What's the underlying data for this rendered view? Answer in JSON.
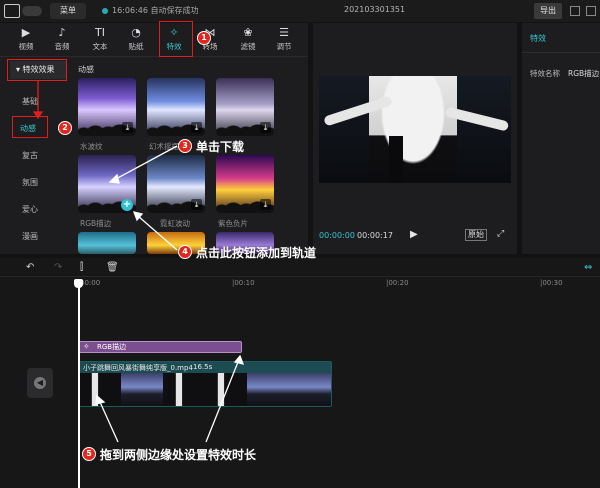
{
  "topbar": {
    "menu_label": "菜单",
    "status_text": "16:06:46 自动保存成功",
    "project_title": "202103301351",
    "export_label": "导出"
  },
  "media_tabs": [
    {
      "label": "视频",
      "icon": "video-icon"
    },
    {
      "label": "音频",
      "icon": "audio-icon"
    },
    {
      "label": "文本",
      "icon": "text-icon"
    },
    {
      "label": "贴纸",
      "icon": "sticker-icon"
    },
    {
      "label": "特效",
      "icon": "effects-icon",
      "active": true
    },
    {
      "label": "转场",
      "icon": "transition-icon"
    },
    {
      "label": "滤镜",
      "icon": "filter-icon"
    },
    {
      "label": "调节",
      "icon": "adjust-icon"
    }
  ],
  "sidebar": {
    "header": "▾ 特效效果",
    "items": [
      "基础",
      "动感",
      "复古",
      "氛围",
      "爱心",
      "漫画"
    ]
  },
  "effects_section": {
    "title": "动感",
    "items": [
      {
        "label": "水波纹"
      },
      {
        "label": "幻术摇摆"
      },
      {
        "label": ""
      },
      {
        "label": "RGB描边"
      },
      {
        "label": "霓虹波动"
      },
      {
        "label": "紫色负片"
      },
      {
        "label": ""
      },
      {
        "label": ""
      },
      {
        "label": ""
      }
    ]
  },
  "player": {
    "current_time": "00:00:00",
    "total_time": "00:00:17",
    "ratio_label": "原始"
  },
  "props": {
    "heading": "特效",
    "name_key": "特效名称",
    "name_value": "RGB描边"
  },
  "timeline": {
    "ruler_labels": [
      "00:00",
      "|00:10",
      "|00:20",
      "|00:30"
    ],
    "effect_clip_label": "RGB描边",
    "video_clip_name": "小子跳舞回风暴街舞纯享版_0.mp4",
    "video_clip_duration": "16.5s"
  },
  "annotations": {
    "step1": "1",
    "step2": "2",
    "step3": "3",
    "step4": "4",
    "step5": "5",
    "text3": "单击下载",
    "text4": "点击此按钮添加到轨道",
    "text5": "拖到两侧边缘处设置特效时长"
  },
  "colors": {
    "accent": "#39c6d3",
    "annotation_red": "#e3261c",
    "effect_clip": "#7a4e8f"
  }
}
